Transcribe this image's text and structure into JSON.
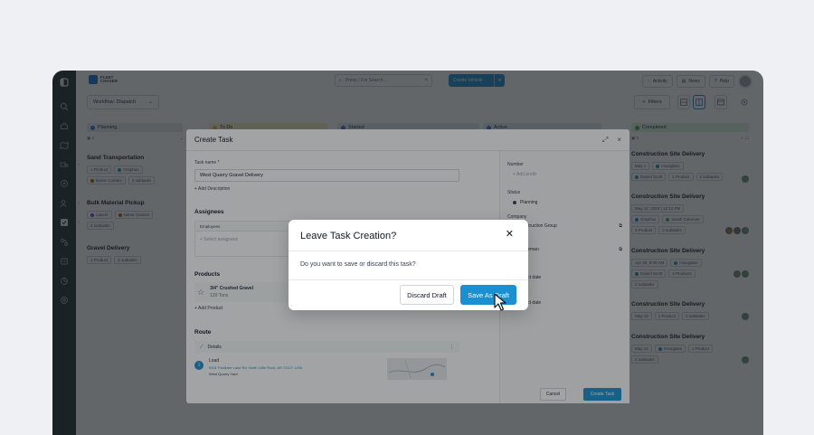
{
  "app": {
    "logo_text": "FLEET CHASER",
    "search_placeholder": "Press / For Search ...",
    "create_vehicle": "Create Vehicle",
    "activity": "Activity",
    "news": "News",
    "help": "Help",
    "workflow_label": "Workflow: Dispatch",
    "filters": "Filters",
    "rail_counts": [
      "4",
      "4",
      "2"
    ]
  },
  "columns": [
    {
      "name": "Planning",
      "color": "#3c6fd1",
      "bg": "#e5eaf3",
      "count": "3"
    },
    {
      "name": "To Do",
      "color": "#e6b84a",
      "bg": "#fdf1c9",
      "count": ""
    },
    {
      "name": "Started",
      "color": "#3c6fd1",
      "bg": "#e4ecf8",
      "count": ""
    },
    {
      "name": "Active",
      "color": "#3c6fd1",
      "bg": "#e4ecf8",
      "count": ""
    },
    {
      "name": "Completed",
      "color": "#3aa85a",
      "bg": "#dcf1e1",
      "count": "5"
    }
  ],
  "planning_cards": [
    {
      "title": "Sand Transportation",
      "chip1": "1 Product",
      "chip2": "Graphus",
      "chip3": "Name Contact",
      "chip4": "2 subtasks"
    },
    {
      "title": "Bulk Material Pickup",
      "chip1": "Lasers",
      "chip2": "Name Contact",
      "chip3": "2 subtasks"
    },
    {
      "title": "Gravel Delivery",
      "chip1": "1 Product",
      "chip2": "2 subtasks"
    }
  ],
  "completed_cards": [
    {
      "title": "Construction Site Delivery",
      "chip1": "May 1",
      "chip2": "Hourglass",
      "chip3": "Daniel Scott",
      "chip4": "1 Product",
      "chip5": "2 subtasks"
    },
    {
      "title": "Construction Site Delivery",
      "chip1": "May 12, 2020 | 12:12 PM",
      "chip2": "Graphus",
      "chip3": "Sarah Coleman",
      "chip4": "3 Product",
      "chip5": "2 subtasks"
    },
    {
      "title": "Construction Site Delivery",
      "chip1": "Apr 28, 8:08 AM",
      "chip2": "Hourglass",
      "chip3": "Daniel Scott",
      "chip4": "4 Products",
      "chip5": "2 subtasks"
    },
    {
      "title": "Construction Site Delivery",
      "chip1": "May 10",
      "chip2": "1 Product",
      "chip3": "2 subtasks"
    },
    {
      "title": "Construction Site Delivery",
      "chip1": "May 10",
      "chip2": "Hourglass",
      "chip3": "1 Product",
      "chip4": "2 subtasks"
    }
  ],
  "task": {
    "title": "Create Task",
    "task_name_label": "Task name *",
    "task_name_value": "West Quarry Gravel Delivery",
    "add_description": "+ Add Description",
    "assignees": "Assignees",
    "employees": "Employees",
    "select_assignees": "+ Select assignees",
    "products": "Products",
    "product_name": "3/4\" Crushed Gravel",
    "product_qty": "120 Tons",
    "add_product": "+ Add Product",
    "route": "Route",
    "details": "Details",
    "stop_type": "Load",
    "stop_address": "9301 Faulkner Lake Rd, North Little Rock, AR 72117, USA",
    "stop_name": "West Quarry Yard",
    "number_label": "Number",
    "add_prefix": "+ Add prefix",
    "status_label": "Status",
    "status_value": "Planning",
    "company_label": "Company",
    "company_value": "Rios Construction Group",
    "contact_label": "Contact",
    "contact_value": "Sarah Coleman",
    "select_date_1": "Select date",
    "select_date_2": "Select date",
    "cancel": "Cancel",
    "create": "Create Task"
  },
  "dialog": {
    "title": "Leave Task Creation?",
    "message": "Do you want to save or discard this task?",
    "discard": "Discard Draft",
    "save": "Save As Draft"
  },
  "colors": {
    "accent": "#1a8fd1",
    "rail": "#243037"
  }
}
